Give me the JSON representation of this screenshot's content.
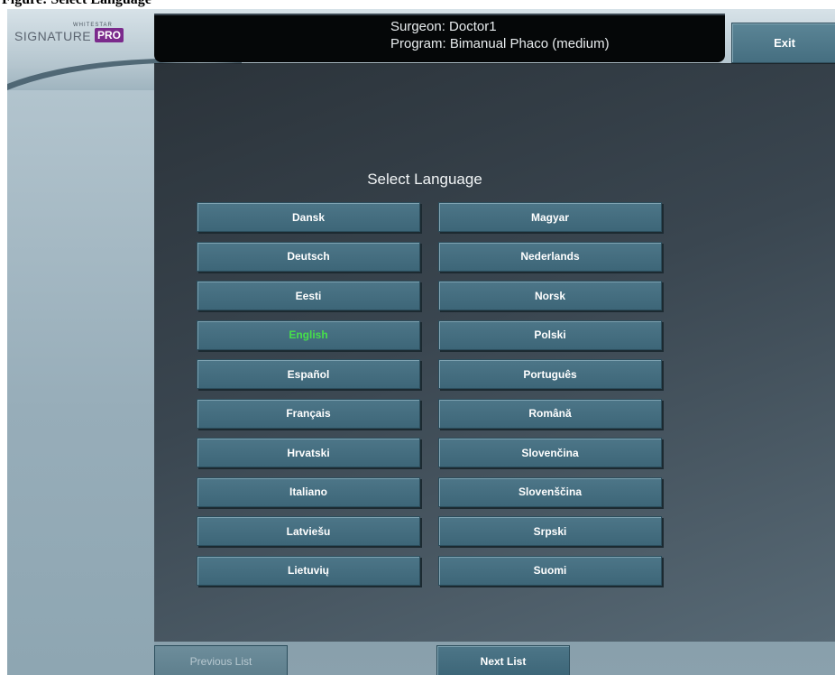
{
  "caption": {
    "text": "Figure: Select Language"
  },
  "header": {
    "logo_small": "WHITESTAR",
    "logo_main": "SIGNATURE",
    "logo_badge": "PRO",
    "surgeon_line": "Surgeon: Doctor1",
    "program_line": "Program: Bimanual Phaco (medium)",
    "exit_label": "Exit"
  },
  "main": {
    "title": "Select Language",
    "selected_language": "English",
    "languages_left": [
      "Dansk",
      "Deutsch",
      "Eesti",
      "English",
      "Español",
      "Français",
      "Hrvatski",
      "Italiano",
      "Latviešu",
      "Lietuvių"
    ],
    "languages_right": [
      "Magyar",
      "Nederlands",
      "Norsk",
      "Polski",
      "Português",
      "Română",
      "Slovenčina",
      "Slovenščina",
      "Srpski",
      "Suomi"
    ],
    "selected_color": "#46e04a"
  },
  "footer": {
    "previous_label": "Previous List",
    "next_label": "Next List"
  }
}
